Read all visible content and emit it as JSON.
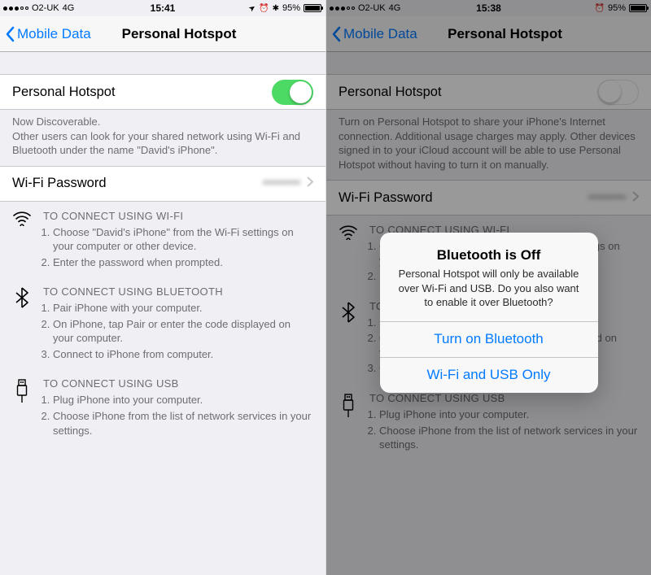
{
  "left": {
    "status": {
      "carrier": "O2-UK",
      "network": "4G",
      "time": "15:41",
      "battery": "95%"
    },
    "nav": {
      "back": "Mobile Data",
      "title": "Personal Hotspot"
    },
    "hotspot": {
      "label": "Personal Hotspot",
      "on": true
    },
    "discoverable": {
      "line1": "Now Discoverable.",
      "line2": "Other users can look for your shared network using Wi-Fi and Bluetooth under the name \"David's iPhone\"."
    },
    "wifi_row": {
      "label": "Wi-Fi Password",
      "value": "••••••••"
    },
    "instructions": {
      "wifi": {
        "title": "TO CONNECT USING WI-FI",
        "steps": [
          "Choose \"David's iPhone\" from the Wi-Fi settings on your computer or other device.",
          "Enter the password when prompted."
        ]
      },
      "bt": {
        "title": "TO CONNECT USING BLUETOOTH",
        "steps": [
          "Pair iPhone with your computer.",
          "On iPhone, tap Pair or enter the code displayed on your computer.",
          "Connect to iPhone from computer."
        ]
      },
      "usb": {
        "title": "TO CONNECT USING USB",
        "steps": [
          "Plug iPhone into your computer.",
          "Choose iPhone from the list of network services in your settings."
        ]
      }
    }
  },
  "right": {
    "status": {
      "carrier": "O2-UK",
      "network": "4G",
      "time": "15:38",
      "battery": "95%"
    },
    "nav": {
      "back": "Mobile Data",
      "title": "Personal Hotspot"
    },
    "hotspot": {
      "label": "Personal Hotspot",
      "on": false
    },
    "off_footer": "Turn on Personal Hotspot to share your iPhone's Internet connection. Additional usage charges may apply. Other devices signed in to your iCloud account will be able to use Personal Hotspot without having to turn it on manually.",
    "wifi_row": {
      "label": "Wi-Fi Password",
      "value": "••••••••"
    },
    "alert": {
      "title": "Bluetooth is Off",
      "message": "Personal Hotspot will only be available over Wi-Fi and USB. Do you also want to enable it over Bluetooth?",
      "button1": "Turn on Bluetooth",
      "button2": "Wi-Fi and USB Only"
    }
  }
}
